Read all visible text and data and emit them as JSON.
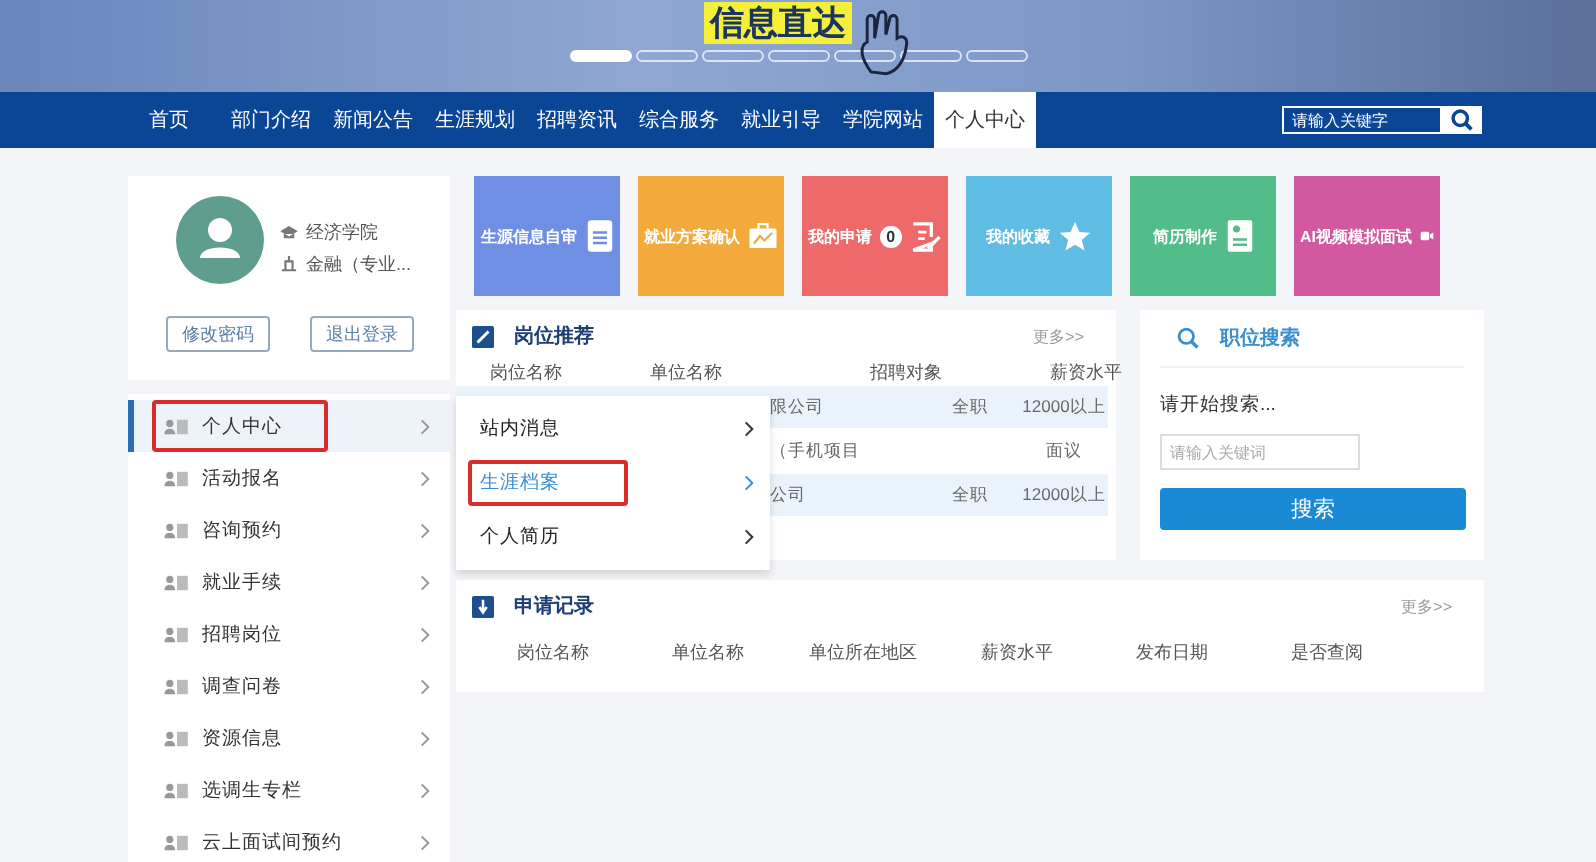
{
  "banner": {
    "headline": "信息直达",
    "slides": [
      {
        "selected": true
      },
      {
        "selected": false
      },
      {
        "selected": false
      },
      {
        "selected": false
      },
      {
        "selected": false
      },
      {
        "selected": false
      },
      {
        "selected": false
      }
    ]
  },
  "nav": {
    "items": [
      {
        "label": "首页",
        "selected": false
      },
      {
        "label": "部门介绍",
        "selected": false
      },
      {
        "label": "新闻公告",
        "selected": false
      },
      {
        "label": "生涯规划",
        "selected": false
      },
      {
        "label": "招聘资讯",
        "selected": false
      },
      {
        "label": "综合服务",
        "selected": false
      },
      {
        "label": "就业引导",
        "selected": false
      },
      {
        "label": "学院网站",
        "selected": false
      },
      {
        "label": "个人中心",
        "selected": true
      }
    ],
    "search": {
      "placeholder": "请输入关键字"
    }
  },
  "profile": {
    "college": "经济学院",
    "major": "金融（专业...",
    "buttons": [
      "修改密码",
      "退出登录"
    ]
  },
  "sidebar": {
    "items": [
      {
        "label": "个人中心",
        "selected": true,
        "annotated": true
      },
      {
        "label": "活动报名",
        "selected": false,
        "annotated": false
      },
      {
        "label": "咨询预约",
        "selected": false,
        "annotated": false
      },
      {
        "label": "就业手续",
        "selected": false,
        "annotated": false
      },
      {
        "label": "招聘岗位",
        "selected": false,
        "annotated": false
      },
      {
        "label": "调查问卷",
        "selected": false,
        "annotated": false
      },
      {
        "label": "资源信息",
        "selected": false,
        "annotated": false
      },
      {
        "label": "选调生专栏",
        "selected": false,
        "annotated": false
      },
      {
        "label": "云上面试间预约",
        "selected": false,
        "annotated": false
      }
    ]
  },
  "submenu": {
    "items": [
      {
        "label": "站内消息",
        "selected": false,
        "annotated": false
      },
      {
        "label": "生涯档案",
        "selected": true,
        "annotated": true
      },
      {
        "label": "个人简历",
        "selected": false,
        "annotated": false
      }
    ]
  },
  "tiles": [
    {
      "label": "生源信息自审",
      "kind": "doc",
      "color": "#6f8fe4"
    },
    {
      "label": "就业方案确认",
      "kind": "chart",
      "color": "#f3aa3c"
    },
    {
      "label": "我的申请",
      "kind": "edit",
      "color": "#ee6a6a",
      "count": "0"
    },
    {
      "label": "我的收藏",
      "kind": "star",
      "color": "#5fbde4"
    },
    {
      "label": "简历制作",
      "kind": "resume",
      "color": "#52bd88"
    },
    {
      "label": "AI视频模拟面试",
      "kind": "video",
      "color": "#d2589f"
    }
  ],
  "job_recommend": {
    "title": "岗位推荐",
    "more": "更多>>",
    "columns": [
      "岗位名称",
      "单位名称",
      "招聘对象",
      "薪资水平"
    ],
    "rows": [
      [
        "限公司",
        "全职",
        "12000以上"
      ],
      [
        "（手机项目",
        "",
        "面议"
      ],
      [
        "公司",
        "全职",
        "12000以上"
      ]
    ]
  },
  "job_search": {
    "title": "职位搜索",
    "prompt": "请开始搜索...",
    "placeholder": "请输入关键词",
    "button": "搜索"
  },
  "applications": {
    "title": "申请记录",
    "more": "更多>>",
    "columns": [
      "岗位名称",
      "单位名称",
      "单位所在地区",
      "薪资水平",
      "发布日期",
      "是否查阅"
    ]
  }
}
